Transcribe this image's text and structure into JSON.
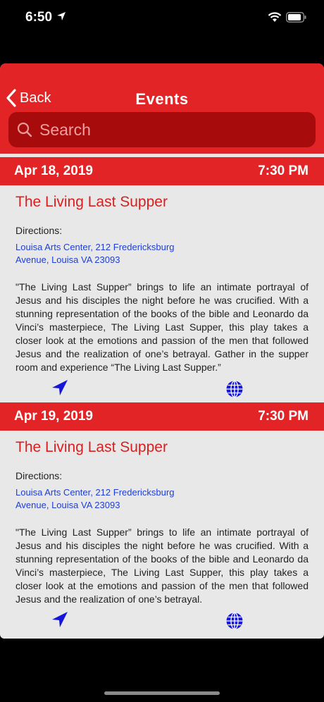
{
  "status": {
    "time": "6:50"
  },
  "nav": {
    "back_label": "Back",
    "title": "Events"
  },
  "search": {
    "placeholder": "Search"
  },
  "events": [
    {
      "date": "Apr 18, 2019",
      "time": "7:30 PM",
      "title": "The Living Last Supper",
      "directions_label": "Directions:",
      "address": "Louisa Arts Center, 212 Fredericksburg Avenue, Louisa VA 23093",
      "description": "\"The Living Last Supper” brings to life an intimate portrayal of Jesus and his disciples the night before he was crucified. With a stunning representation of the books of the bible and Leonardo da Vinci’s masterpiece, The Living Last Supper, this play takes a closer look at the emotions and passion of the men that followed Jesus and the realization of one’s betrayal. Gather in the supper room and experience “The Living Last Supper.”"
    },
    {
      "date": "Apr 19, 2019",
      "time": "7:30 PM",
      "title": "The Living Last Supper",
      "directions_label": "Directions:",
      "address": "Louisa Arts Center, 212 Fredericksburg Avenue, Louisa VA 23093",
      "description": "\"The Living Last Supper” brings to life an intimate portrayal of Jesus and his disciples the night before he was crucified. With a stunning representation of the books of the bible and Leonardo da Vinci’s masterpiece, The Living Last Supper, this play takes a closer look at the emotions and passion of the men that followed Jesus and the realization of one’s betrayal."
    }
  ],
  "colors": {
    "accent": "#e22426",
    "link": "#1f3ed6",
    "icon": "#1616d8"
  }
}
